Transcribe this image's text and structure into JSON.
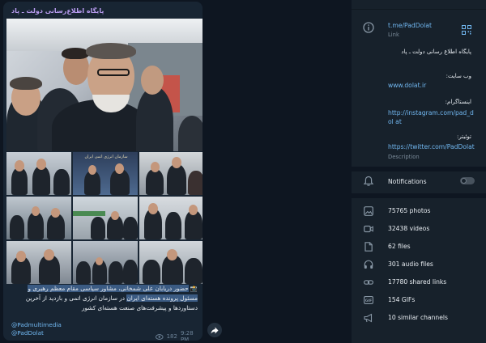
{
  "message": {
    "sender": "پایگاه اطلاع‌رسانی دولت ـ پاد",
    "caption_prefix": "📸 ",
    "caption_highlight_1": "حضور دریابان علی شمخانی، مشاور سیاسی مقام معظم رهبری و ",
    "caption_highlight_2": "مسئول پرونده هسته‌ای ایران",
    "caption_rest": " در سازمان انرژی اتمی و بازدید از آخرین دستاوردها و پیشرفت‌های صنعت هسته‌ای کشور",
    "mention_1": "@Padmultimedia",
    "mention_2": "@PadDolat",
    "views": "182",
    "time": "9:28 PM",
    "grid_text_overlay": "سازمان انرژی اتمی ایران"
  },
  "profile": {
    "link": "t.me/PadDolat",
    "link_label": "Link",
    "description_title": "پایگاه اطلاع رسانی دولت ـ پاد",
    "website_label": "وب سایت:",
    "website": "www.dolat.ir",
    "instagram_label": "اینستاگرام:",
    "instagram": "http://instagram.com/pad_dol at",
    "twitter_label": "توئیتر:",
    "twitter": "https://twitter.com/PadDolat",
    "description_label": "Description",
    "notifications_label": "Notifications",
    "notifications_on": false
  },
  "media": {
    "photos": "75765 photos",
    "videos": "32438 videos",
    "files": "62 files",
    "audio": "301 audio files",
    "links": "17780 shared links",
    "gifs": "154 GIFs",
    "similar": "10 similar channels"
  },
  "icons": {
    "info": "info-circle-icon",
    "qr": "qr-code-icon",
    "bell": "bell-icon",
    "photo": "photo-icon",
    "video": "video-icon",
    "file": "file-icon",
    "audio": "headphones-icon",
    "link": "link-icon",
    "gif": "gif-icon",
    "megaphone": "megaphone-icon",
    "forward": "forward-arrow-icon",
    "eye": "eye-icon"
  },
  "colors": {
    "background": "#0e1621",
    "bubble": "#182533",
    "panel": "#17212b",
    "link": "#71b7f0",
    "sender": "#b99cf0",
    "muted": "#7a8a99"
  }
}
